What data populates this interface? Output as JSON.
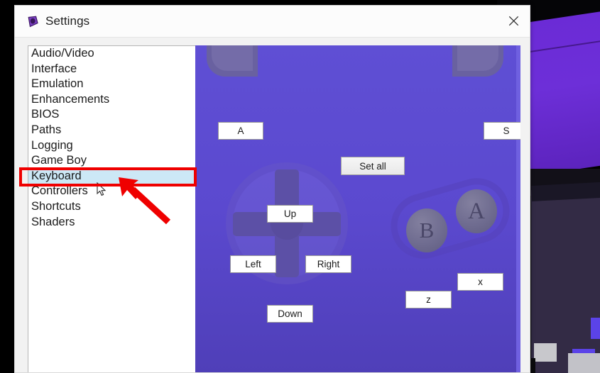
{
  "window": {
    "title": "Settings",
    "icon": "app-diamond-icon",
    "close_label": "✕",
    "accent_color": "#5f4fd4"
  },
  "sidebar": {
    "items": [
      {
        "label": "Audio/Video",
        "selected": false
      },
      {
        "label": "Interface",
        "selected": false
      },
      {
        "label": "Emulation",
        "selected": false
      },
      {
        "label": "Enhancements",
        "selected": false
      },
      {
        "label": "BIOS",
        "selected": false
      },
      {
        "label": "Paths",
        "selected": false
      },
      {
        "label": "Logging",
        "selected": false
      },
      {
        "label": "Game Boy",
        "selected": false
      },
      {
        "label": "Keyboard",
        "selected": true
      },
      {
        "label": "Controllers",
        "selected": false
      },
      {
        "label": "Shortcuts",
        "selected": false
      },
      {
        "label": "Shaders",
        "selected": false
      }
    ]
  },
  "gamepad": {
    "set_all_label": "Set all",
    "face_buttons": [
      {
        "name": "B",
        "glyph": "B"
      },
      {
        "name": "A",
        "glyph": "A"
      }
    ],
    "bindings": {
      "shoulder_left": "A",
      "shoulder_right": "S",
      "dpad_up": "Up",
      "dpad_left": "Left",
      "dpad_right": "Right",
      "dpad_down": "Down",
      "button_b": "z",
      "button_a": "x"
    }
  },
  "annotations": {
    "highlight_color": "#ef0000",
    "highlight_target": "Keyboard",
    "arrow_color": "#ef0000"
  }
}
